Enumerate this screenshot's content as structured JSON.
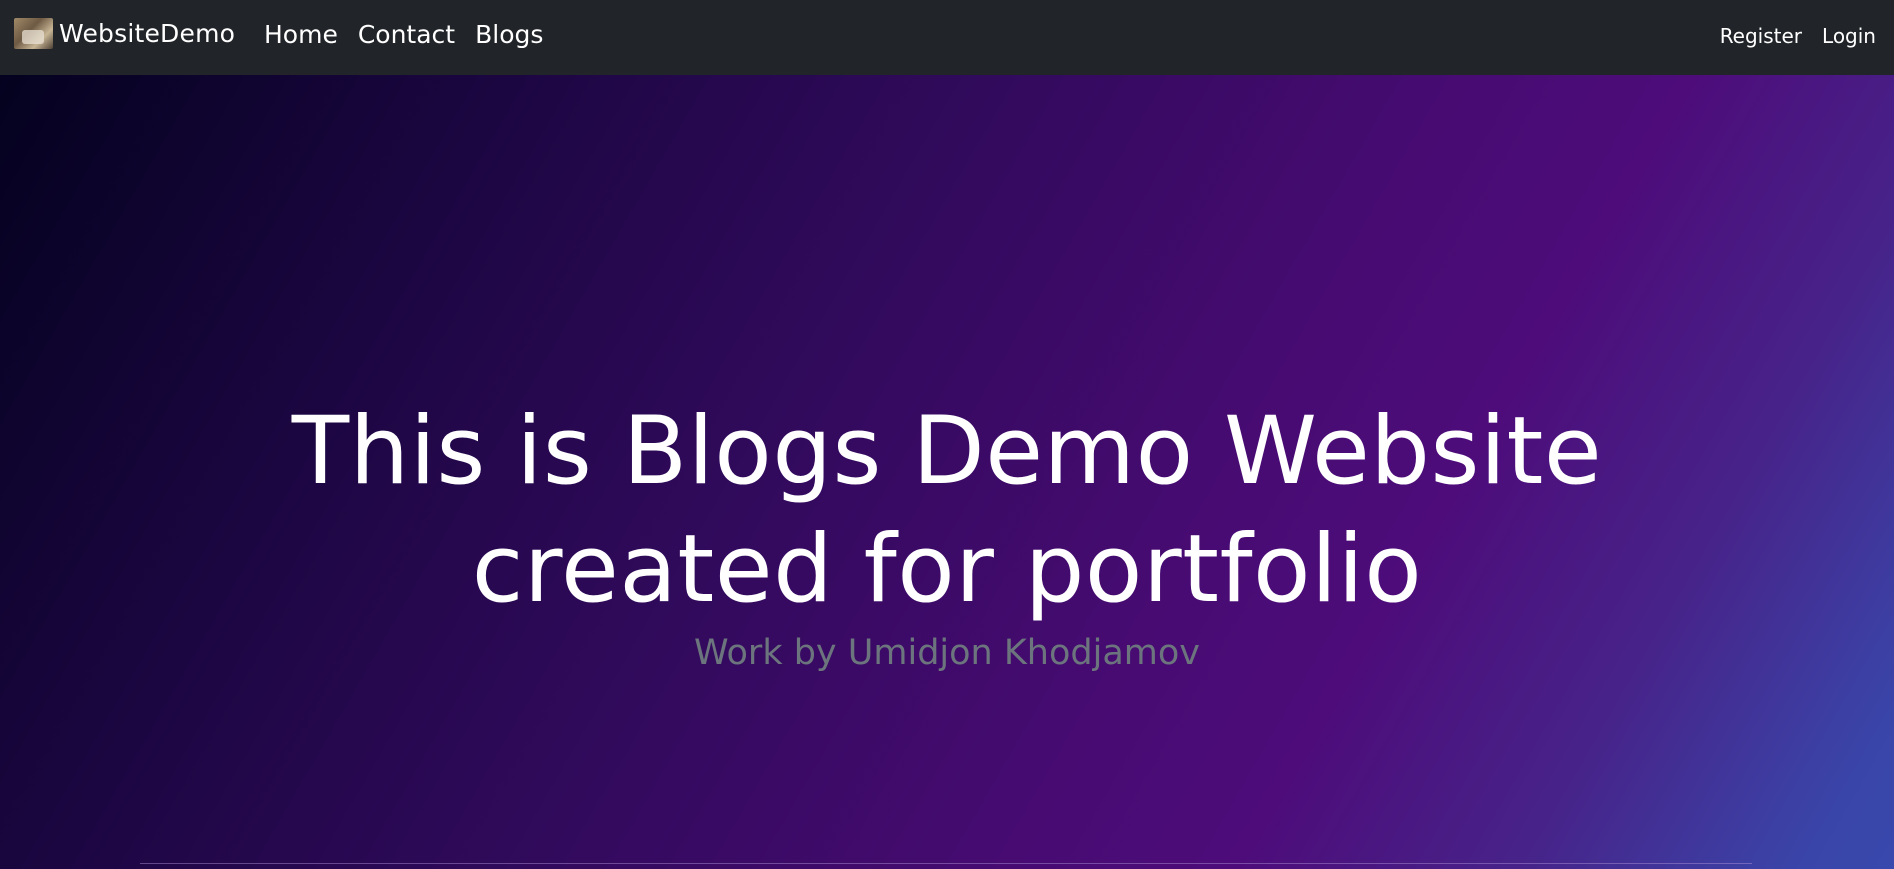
{
  "navbar": {
    "brand": {
      "logo_icon": "brand-logo-image",
      "name": "WebsiteDemo"
    },
    "links": [
      {
        "label": "Home"
      },
      {
        "label": "Contact"
      },
      {
        "label": "Blogs"
      }
    ],
    "auth": {
      "register_label": "Register",
      "login_label": "Login"
    },
    "background_color": "#212529"
  },
  "hero": {
    "title_line_1": "This is Blogs Demo Website",
    "title_line_2": "created for portfolio",
    "subtitle": "Work by Umidjon Khodjamov",
    "subtitle_color": "#6c757d",
    "title_color": "#ffffff",
    "gradient_colors": [
      "#04021f",
      "#310a5c",
      "#4d0c7a",
      "#3848ac"
    ]
  }
}
